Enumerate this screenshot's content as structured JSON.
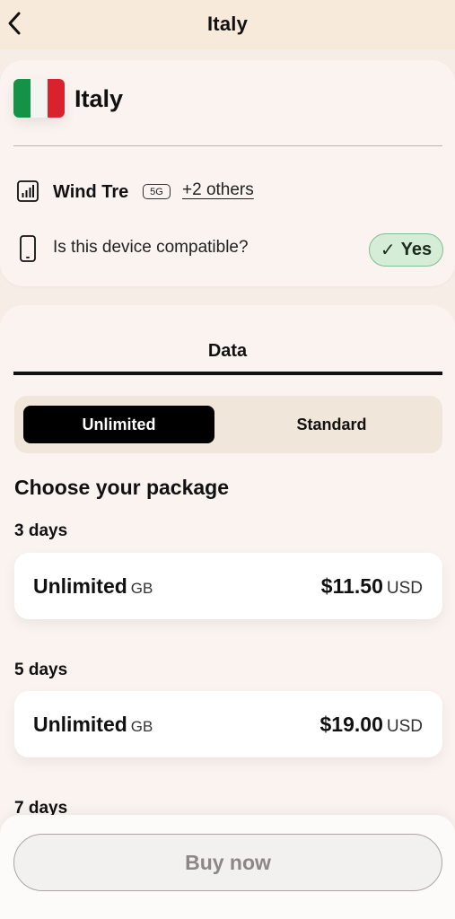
{
  "header": {
    "title": "Italy"
  },
  "country": {
    "name": "Italy",
    "flag_colors": [
      "#149246",
      "#f4f4f0",
      "#d8232f"
    ],
    "network": "Wind Tre",
    "network_badge": "5G",
    "others_link": "+2 others",
    "device_question": "Is this device compatible?",
    "compatible_label": "Yes",
    "compatible_check": "✓"
  },
  "tabs": {
    "data_label": "Data"
  },
  "segment": {
    "unlimited_label": "Unlimited",
    "standard_label": "Standard"
  },
  "packages": {
    "title": "Choose your package",
    "items": [
      {
        "days": "3 days",
        "amount": "Unlimited",
        "unit": "GB",
        "price": "$11.50",
        "currency": "USD"
      },
      {
        "days": "5 days",
        "amount": "Unlimited",
        "unit": "GB",
        "price": "$19.00",
        "currency": "USD"
      },
      {
        "days": "7 days"
      }
    ]
  },
  "footer": {
    "buy_label": "Buy now"
  }
}
